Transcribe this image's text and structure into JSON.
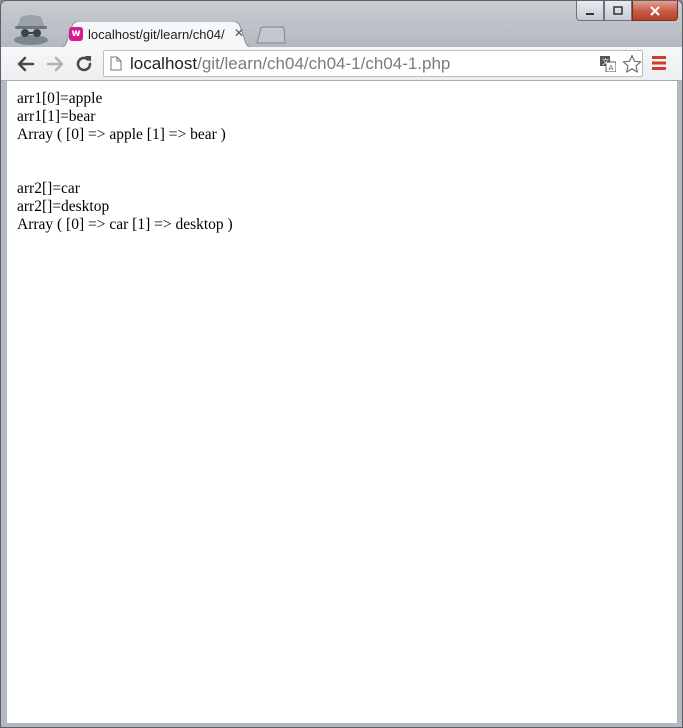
{
  "browser": {
    "tab": {
      "title": "localhost/git/learn/ch04/",
      "favicon": "wamp-favicon-icon"
    },
    "address": {
      "host": "localhost",
      "path": "/git/learn/ch04/ch04-1/ch04-1.php"
    },
    "colors": {
      "favicon": "#d6198f",
      "menu": "#d23a2c",
      "close_button": "#c75a45"
    }
  },
  "page": {
    "block1": [
      "arr1[0]=apple",
      "arr1[1]=bear",
      "Array ( [0] => apple [1] => bear )"
    ],
    "block2": [
      "arr2[]=car",
      "arr2[]=desktop",
      "Array ( [0] => car [1] => desktop )"
    ]
  }
}
